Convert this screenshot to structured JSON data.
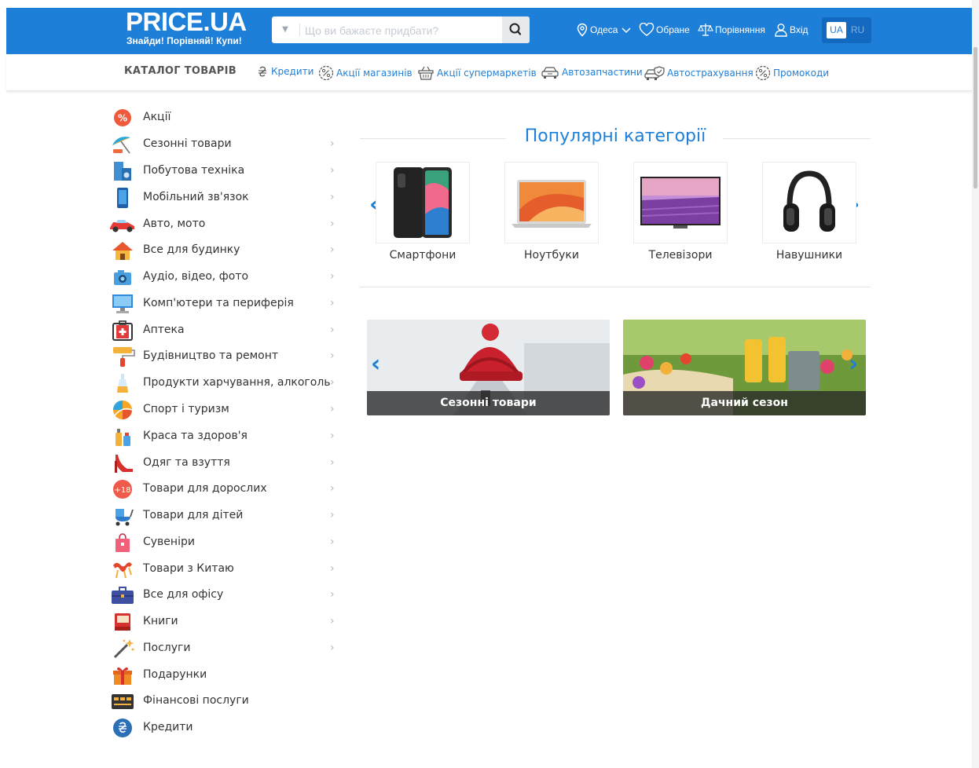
{
  "header": {
    "logo_title": "PRICE.UA",
    "logo_slogan": "Знайди! Порівняй! Купи!",
    "search_placeholder": "Що ви бажаєте придбати?",
    "city": "Одеса",
    "favorites": "Обране",
    "compare": "Порівняння",
    "login": "Вхід",
    "lang_active": "UA",
    "lang_other": "RU",
    "brand_color": "#1e7fd8"
  },
  "catalog_bar": {
    "title": "КАТАЛОГ ТОВАРІВ",
    "links": [
      {
        "label": "Кредити",
        "icon": "hryvnia-icon"
      },
      {
        "label": "Акції магазинів",
        "icon": "percent-badge-icon"
      },
      {
        "label": "Акції супермаркетів",
        "icon": "basket-icon"
      },
      {
        "label": "Автозапчастини",
        "icon": "car-icon"
      },
      {
        "label": "Автострахування",
        "icon": "car-shield-icon"
      },
      {
        "label": "Промокоди",
        "icon": "percent-badge-icon"
      }
    ]
  },
  "sidebar": {
    "items": [
      {
        "label": "Акції",
        "icon": "sale-icon",
        "arrow": ""
      },
      {
        "label": "Сезонні товари",
        "icon": "umbrella-icon",
        "arrow": "›"
      },
      {
        "label": "Побутова техніка",
        "icon": "fridge-washer-icon",
        "arrow": "›"
      },
      {
        "label": "Мобільний зв'язок",
        "icon": "phone-icon",
        "arrow": "›"
      },
      {
        "label": "Авто, мото",
        "icon": "car-icon",
        "arrow": "›"
      },
      {
        "label": "Все для будинку",
        "icon": "house-icon",
        "arrow": "›"
      },
      {
        "label": "Аудіо, відео, фото",
        "icon": "camera-icon",
        "arrow": "›"
      },
      {
        "label": "Комп'ютери та периферія",
        "icon": "monitor-icon",
        "arrow": "›"
      },
      {
        "label": "Аптека",
        "icon": "first-aid-icon",
        "arrow": "›"
      },
      {
        "label": "Будівництво та ремонт",
        "icon": "paint-roller-icon",
        "arrow": "›"
      },
      {
        "label": "Продукти харчування, алкоголь",
        "icon": "bottle-icon",
        "arrow": "›"
      },
      {
        "label": "Спорт і туризм",
        "icon": "ball-icon",
        "arrow": "›"
      },
      {
        "label": "Краса та здоров'я",
        "icon": "cosmetics-icon",
        "arrow": "›"
      },
      {
        "label": "Одяг та взуття",
        "icon": "high-heel-icon",
        "arrow": "›"
      },
      {
        "label": "Товари для дорослих",
        "icon": "adult-18-icon",
        "arrow": "›"
      },
      {
        "label": "Товари для дітей",
        "icon": "stroller-icon",
        "arrow": "›"
      },
      {
        "label": "Сувеніри",
        "icon": "gift-bag-icon",
        "arrow": "›"
      },
      {
        "label": "Товари з Китаю",
        "icon": "dragon-icon",
        "arrow": "›"
      },
      {
        "label": "Все для офісу",
        "icon": "briefcase-icon",
        "arrow": "›"
      },
      {
        "label": "Книги",
        "icon": "book-icon",
        "arrow": "›"
      },
      {
        "label": "Послуги",
        "icon": "magic-wand-icon",
        "arrow": "›"
      },
      {
        "label": "Подарунки",
        "icon": "gift-icon",
        "arrow": ""
      },
      {
        "label": "Фінансові послуги",
        "icon": "card-icon",
        "arrow": ""
      },
      {
        "label": "Кредити",
        "icon": "hryvnia-coin-icon",
        "arrow": ""
      }
    ]
  },
  "popular": {
    "title": "Популярні категорії",
    "categories": [
      {
        "label": "Смартфони",
        "icon": "smartphone-image"
      },
      {
        "label": "Ноутбуки",
        "icon": "laptop-image"
      },
      {
        "label": "Телевізори",
        "icon": "tv-image"
      },
      {
        "label": "Навушники",
        "icon": "headphones-image"
      }
    ],
    "prev": "‹",
    "next": "›"
  },
  "banners": [
    {
      "label": "Сезонні товари"
    },
    {
      "label": "Дачний сезон"
    }
  ]
}
